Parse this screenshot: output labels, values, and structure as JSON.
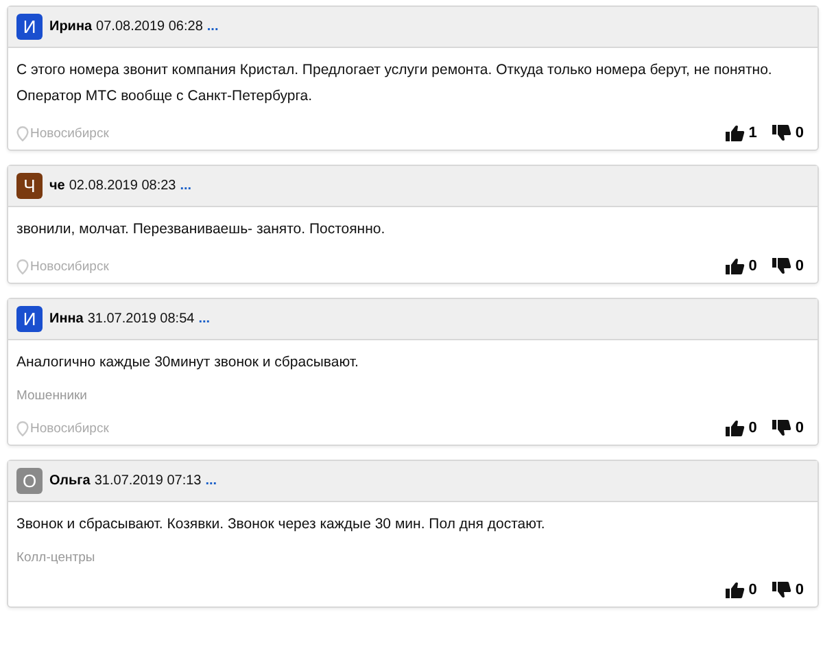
{
  "comments": [
    {
      "initial": "И",
      "color": "#1a4fcf",
      "author": "Ирина",
      "date": "07.08.2019 06:28",
      "more": "...",
      "text": [
        "С этого номера звонит компания Кристал. Предлогает услуги ремонта. Откуда только номера берут, не понятно.",
        "Оператор МТС вообще с Санкт-Петербурга."
      ],
      "location": "Новосибирск",
      "likes": "1",
      "dislikes": "0"
    },
    {
      "initial": "Ч",
      "color": "#7a3a10",
      "author": "че",
      "date": "02.08.2019 08:23",
      "more": "...",
      "text": [
        "звонили, молчат. Перезваниваешь- занято. Постоянно."
      ],
      "location": "Новосибирск",
      "likes": "0",
      "dislikes": "0"
    },
    {
      "initial": "И",
      "color": "#1a4fcf",
      "author": "Инна",
      "date": "31.07.2019 08:54",
      "more": "...",
      "text": [
        "Аналогично каждые 30минут звонок и сбрасывают."
      ],
      "category": "Мошенники",
      "location": "Новосибирск",
      "likes": "0",
      "dislikes": "0"
    },
    {
      "initial": "О",
      "color": "#8a8a8a",
      "author": "Ольга",
      "date": "31.07.2019 07:13",
      "more": "...",
      "text": [
        "Звонок и сбрасывают. Козявки. Звонок через каждые 30 мин. Пол дня достают."
      ],
      "category": "Колл-центры",
      "likes": "0",
      "dislikes": "0"
    }
  ]
}
